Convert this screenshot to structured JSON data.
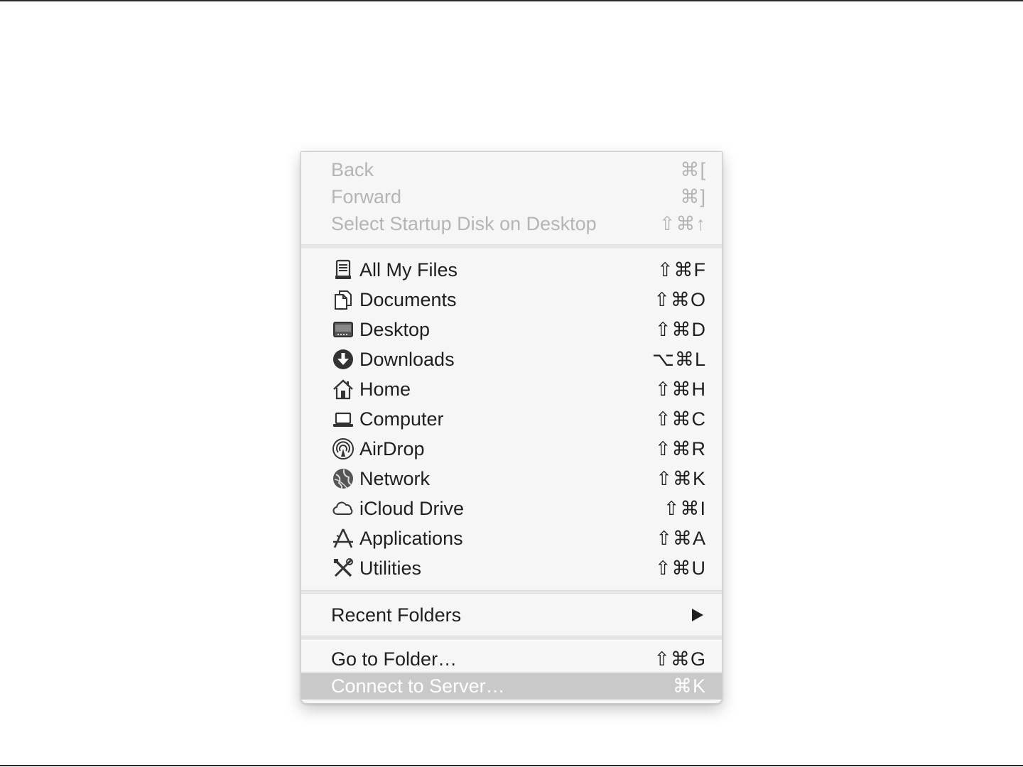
{
  "menu": {
    "nav": [
      {
        "label": "Back",
        "shortcut": "⌘[",
        "enabled": false
      },
      {
        "label": "Forward",
        "shortcut": "⌘]",
        "enabled": false
      },
      {
        "label": "Select Startup Disk on Desktop",
        "shortcut": "⇧⌘↑",
        "enabled": false
      }
    ],
    "places": [
      {
        "label": "All My Files",
        "shortcut": "⇧⌘F",
        "icon": "all-files-icon"
      },
      {
        "label": "Documents",
        "shortcut": "⇧⌘O",
        "icon": "documents-icon"
      },
      {
        "label": "Desktop",
        "shortcut": "⇧⌘D",
        "icon": "desktop-icon"
      },
      {
        "label": "Downloads",
        "shortcut": "⌥⌘L",
        "icon": "downloads-icon"
      },
      {
        "label": "Home",
        "shortcut": "⇧⌘H",
        "icon": "home-icon"
      },
      {
        "label": "Computer",
        "shortcut": "⇧⌘C",
        "icon": "computer-icon"
      },
      {
        "label": "AirDrop",
        "shortcut": "⇧⌘R",
        "icon": "airdrop-icon"
      },
      {
        "label": "Network",
        "shortcut": "⇧⌘K",
        "icon": "network-icon"
      },
      {
        "label": "iCloud Drive",
        "shortcut": "⇧⌘I",
        "icon": "icloud-icon"
      },
      {
        "label": "Applications",
        "shortcut": "⇧⌘A",
        "icon": "applications-icon"
      },
      {
        "label": "Utilities",
        "shortcut": "⇧⌘U",
        "icon": "utilities-icon"
      }
    ],
    "recent": {
      "label": "Recent Folders",
      "icon": "submenu-arrow-icon"
    },
    "actions": [
      {
        "label": "Go to Folder…",
        "shortcut": "⇧⌘G",
        "highlighted": false
      },
      {
        "label": "Connect to Server…",
        "shortcut": "⌘K",
        "highlighted": true
      }
    ],
    "colors": {
      "background": "#f6f6f6",
      "text": "#1f1f1f",
      "disabled_text": "#b5b5b5",
      "highlight": "#c9c9c9"
    }
  }
}
